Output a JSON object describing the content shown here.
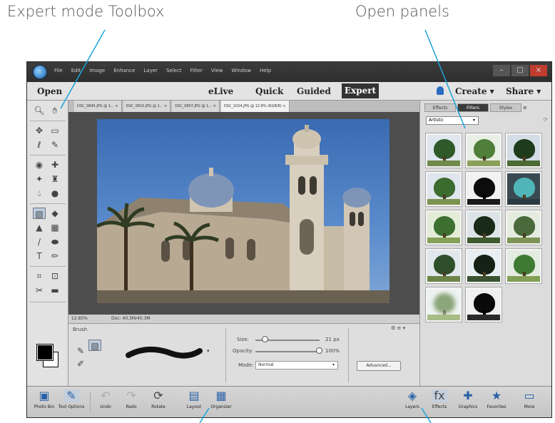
{
  "callouts": {
    "toolbox": "Expert mode Toolbox",
    "panels": "Open panels"
  },
  "menu": [
    "File",
    "Edit",
    "Image",
    "Enhance",
    "Layer",
    "Select",
    "Filter",
    "View",
    "Window",
    "Help"
  ],
  "modebar": {
    "open": "Open",
    "elive": "eLive",
    "quick": "Quick",
    "guided": "Guided",
    "expert": "Expert",
    "create": "Create ▾",
    "share": "Share ▾"
  },
  "doc_tabs": [
    "DSC_0845.JPG @ 1... ×",
    "DSC_0815.JPG @ 1... ×",
    "DSC_0807.JPG @ 1... ×",
    "DSC_1024.JPG @ 12.8% (RGB/8) ×"
  ],
  "status": {
    "zoom": "12.85%",
    "doc": "Doc: 40.3M/40.3M"
  },
  "tool_options": {
    "preset_label": "Brush",
    "size_label": "Size:",
    "size_value": "21 px",
    "opacity_label": "Opacity:",
    "opacity_value": "100%",
    "opacity_level": 1.0,
    "size_level": 0.15,
    "mode_label": "Mode:",
    "mode_value": "Normal",
    "advanced": "Advanced..."
  },
  "panels": {
    "tabs": [
      "Effects",
      "Filters",
      "Styles"
    ],
    "active_tab": "Filters",
    "category": "Artistic"
  },
  "bottom_bar": [
    {
      "label": "Photo Bin",
      "icon": "photo-bin-icon"
    },
    {
      "label": "Tool Options",
      "icon": "tool-options-icon"
    },
    {
      "label": "Undo",
      "icon": "undo-icon"
    },
    {
      "label": "Redo",
      "icon": "redo-icon"
    },
    {
      "label": "Rotate",
      "icon": "rotate-icon"
    },
    {
      "label": "Layout",
      "icon": "layout-icon"
    },
    {
      "label": "Organizer",
      "icon": "organizer-icon"
    },
    {
      "label": "Layers",
      "icon": "layers-icon"
    },
    {
      "label": "Effects",
      "icon": "effects-icon"
    },
    {
      "label": "Graphics",
      "icon": "graphics-icon"
    },
    {
      "label": "Favorites",
      "icon": "favorites-icon"
    },
    {
      "label": "More",
      "icon": "more-icon"
    }
  ],
  "colors": {
    "callout_line": "#1aa3d9",
    "expert_tab": "#333333",
    "accent": "#2a62a8"
  }
}
